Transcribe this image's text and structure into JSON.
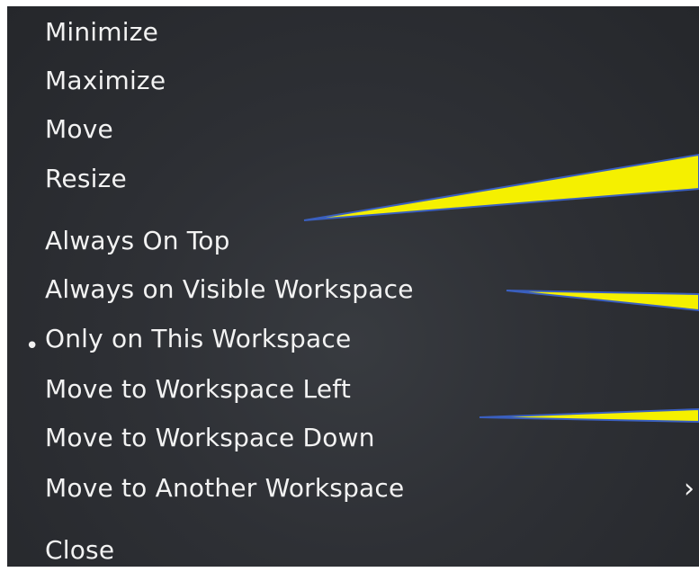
{
  "menu": {
    "items": [
      {
        "label": "Minimize"
      },
      {
        "label": "Maximize"
      },
      {
        "label": "Move"
      },
      {
        "label": "Resize"
      },
      {
        "label": "Always On Top"
      },
      {
        "label": "Always on Visible Workspace"
      },
      {
        "label": "Only on This Workspace",
        "selected": true
      },
      {
        "label": "Move to Workspace Left"
      },
      {
        "label": "Move to Workspace Down"
      },
      {
        "label": "Move to Another Workspace",
        "has_submenu": true
      },
      {
        "label": "Close"
      }
    ],
    "bullet_glyph": "•",
    "submenu_glyph": "›"
  },
  "colors": {
    "text": "#f2f2f2",
    "background": "#2e3035",
    "callout_fill": "#f5f000",
    "callout_stroke": "#3a5fbf"
  },
  "icons": [
    "selected-bullet-icon",
    "submenu-chevron-icon"
  ]
}
